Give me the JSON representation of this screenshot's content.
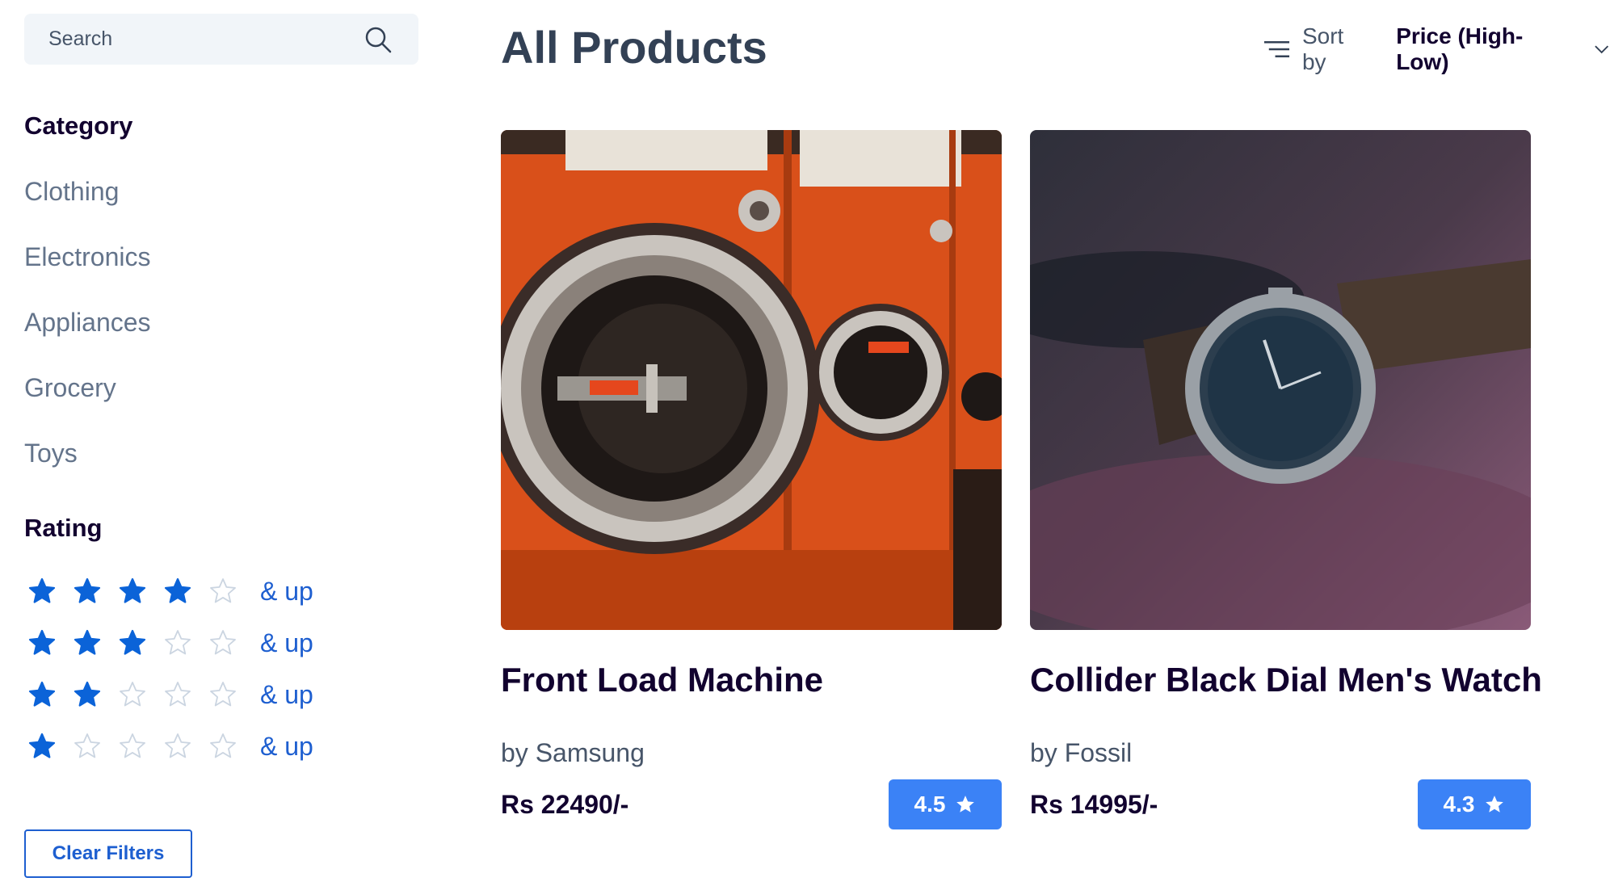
{
  "search": {
    "placeholder": "Search"
  },
  "category": {
    "title": "Category",
    "items": [
      "Clothing",
      "Electronics",
      "Appliances",
      "Grocery",
      "Toys"
    ]
  },
  "rating": {
    "title": "Rating",
    "options": [
      {
        "stars": 4,
        "label": "& up"
      },
      {
        "stars": 3,
        "label": "& up"
      },
      {
        "stars": 2,
        "label": "& up"
      },
      {
        "stars": 1,
        "label": "& up"
      }
    ]
  },
  "clear_filters_label": "Clear Filters",
  "header": {
    "title": "All Products",
    "sort_label": "Sort by",
    "sort_value": "Price (High-Low)"
  },
  "products": [
    {
      "title": "Front Load Machine",
      "brand": "by Samsung",
      "price": "Rs 22490/-",
      "rating": "4.5",
      "image": "orange-washing-machines"
    },
    {
      "title": "Collider Black Dial Men's Watch",
      "brand": "by Fossil",
      "price": "Rs 14995/-",
      "rating": "4.3",
      "image": "wrist-watch-on-leather"
    }
  ],
  "colors": {
    "accent": "#1e5fd0",
    "badge": "#3b82f6",
    "filled_star": "#0b63d8",
    "empty_star": "#cbd5e1",
    "heading": "#12022f",
    "muted": "#64748b"
  }
}
